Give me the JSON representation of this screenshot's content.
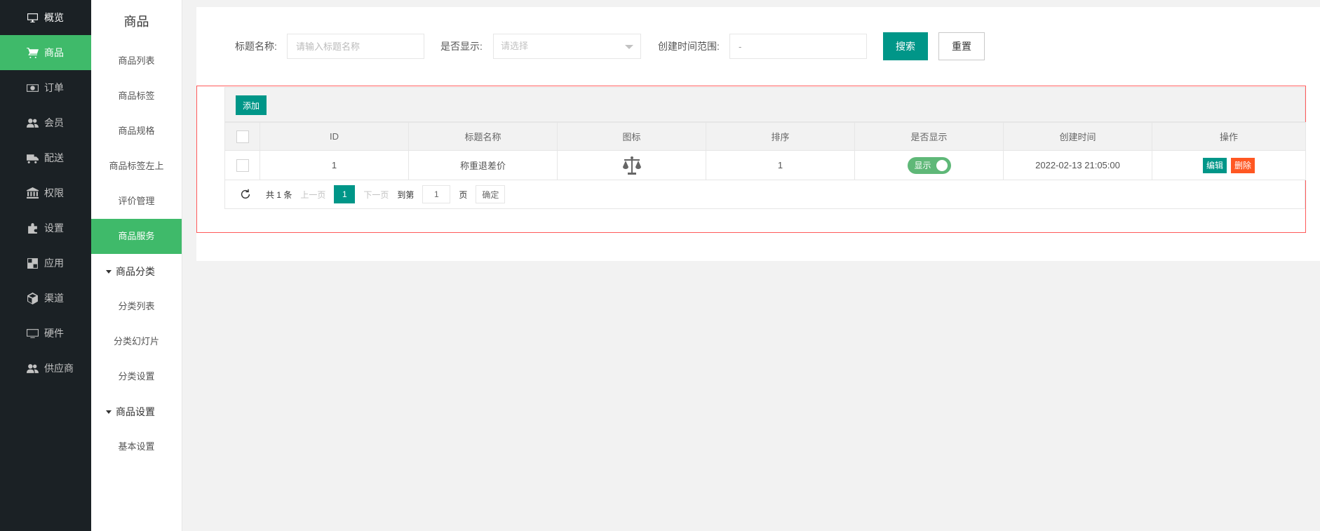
{
  "nav": {
    "items": [
      {
        "label": "概览",
        "icon": "monitor-icon"
      },
      {
        "label": "商品",
        "icon": "cart-icon"
      },
      {
        "label": "订单",
        "icon": "money-icon"
      },
      {
        "label": "会员",
        "icon": "users-icon"
      },
      {
        "label": "配送",
        "icon": "truck-icon"
      },
      {
        "label": "权限",
        "icon": "bank-icon"
      },
      {
        "label": "设置",
        "icon": "puzzle-icon"
      },
      {
        "label": "应用",
        "icon": "apps-icon"
      },
      {
        "label": "渠道",
        "icon": "cube-icon"
      },
      {
        "label": "硬件",
        "icon": "desktop-icon"
      },
      {
        "label": "供应商",
        "icon": "users-icon"
      }
    ],
    "active_color": "#3fba6a",
    "bg_color": "#1b2125"
  },
  "sub": {
    "title": "商品",
    "items": [
      "商品列表",
      "商品标签",
      "商品规格",
      "商品标签左上",
      "评价管理",
      "商品服务"
    ],
    "group1": {
      "label": "商品分类",
      "items": [
        "分类列表",
        "分类幻灯片",
        "分类设置"
      ]
    },
    "group2": {
      "label": "商品设置",
      "items": [
        "基本设置"
      ]
    }
  },
  "filters": {
    "title_label": "标题名称:",
    "title_placeholder": "请输入标题名称",
    "show_label": "是否显示:",
    "show_placeholder": "请选择",
    "time_label": "创建时间范围:",
    "time_value": "-",
    "search_btn": "搜索",
    "reset_btn": "重置"
  },
  "table": {
    "add_btn": "添加",
    "columns": [
      "ID",
      "标题名称",
      "图标",
      "排序",
      "是否显示",
      "创建时间",
      "操作"
    ],
    "rows": [
      {
        "id": "1",
        "title": "称重退差价",
        "icon": "scale-icon",
        "sort": "1",
        "show": "显示",
        "created": "2022-02-13 21:05:00",
        "edit": "编辑",
        "delete": "删除"
      }
    ]
  },
  "pager": {
    "total": "共 1 条",
    "prev": "上一页",
    "current": "1",
    "next": "下一页",
    "goto": "到第",
    "page_value": "1",
    "page_unit": "页",
    "confirm": "确定"
  },
  "colors": {
    "primary": "#009688",
    "danger": "#ff5722",
    "switch_on": "#5fb878",
    "highlight_border": "#ff5a5a"
  }
}
